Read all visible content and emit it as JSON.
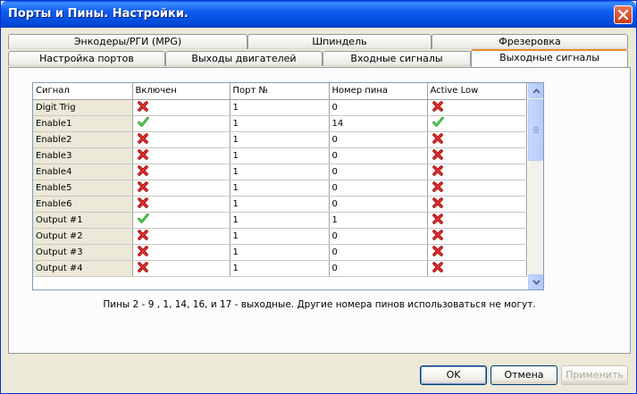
{
  "window": {
    "title": "Порты и Пины.   Настройки."
  },
  "tabs_back": [
    "Энкодеры/РГИ (MPG)",
    "Шпиндель",
    "Фрезеровка"
  ],
  "tabs_front": [
    "Настройка портов",
    "Выходы двигателей",
    "Входные сигналы",
    "Выходные сигналы"
  ],
  "active_tab": "Выходные сигналы",
  "grid": {
    "headers": [
      "Сигнал",
      "Включен",
      "Порт №",
      "Номер пина",
      "Active Low"
    ],
    "rows": [
      {
        "signal": "Digit  Trig",
        "enabled": false,
        "port": "1",
        "pin": "0",
        "active_low": false
      },
      {
        "signal": "Enable1",
        "enabled": true,
        "port": "1",
        "pin": "14",
        "active_low": true
      },
      {
        "signal": "Enable2",
        "enabled": false,
        "port": "1",
        "pin": "0",
        "active_low": false
      },
      {
        "signal": "Enable3",
        "enabled": false,
        "port": "1",
        "pin": "0",
        "active_low": false
      },
      {
        "signal": "Enable4",
        "enabled": false,
        "port": "1",
        "pin": "0",
        "active_low": false
      },
      {
        "signal": "Enable5",
        "enabled": false,
        "port": "1",
        "pin": "0",
        "active_low": false
      },
      {
        "signal": "Enable6",
        "enabled": false,
        "port": "1",
        "pin": "0",
        "active_low": false
      },
      {
        "signal": "Output #1",
        "enabled": true,
        "port": "1",
        "pin": "1",
        "active_low": false
      },
      {
        "signal": "Output #2",
        "enabled": false,
        "port": "1",
        "pin": "0",
        "active_low": false
      },
      {
        "signal": "Output #3",
        "enabled": false,
        "port": "1",
        "pin": "0",
        "active_low": false
      },
      {
        "signal": "Output #4",
        "enabled": false,
        "port": "1",
        "pin": "0",
        "active_low": false
      }
    ],
    "icons": {
      "true": "green-check-icon",
      "false": "red-x-icon"
    }
  },
  "note": "Пины 2 - 9 , 1, 14, 16, и 17 - выходные. Другие номера пинов использоваться не могут.",
  "buttons": {
    "ok": "OK",
    "cancel": "Отмена",
    "apply": "Применить"
  },
  "colors": {
    "titlebar": "#0054e3",
    "check": "#22b422",
    "cross": "#d41818",
    "tab_highlight": "#e68b2c"
  }
}
